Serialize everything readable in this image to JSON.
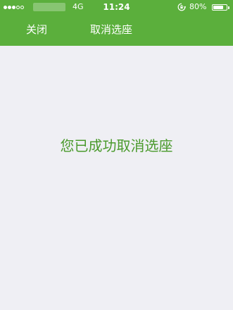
{
  "status_bar": {
    "signal_bars_filled": 3,
    "signal_bars_total": 5,
    "network": "4G",
    "time": "11:24",
    "battery_percent_label": "80%",
    "battery_level": 0.8,
    "icons": [
      "signal-icon",
      "rotation-lock-icon",
      "battery-icon"
    ]
  },
  "nav": {
    "close_label": "关闭",
    "title": "取消选座"
  },
  "main": {
    "message": "您已成功取消选座"
  },
  "colors": {
    "brand_green": "#5BAF3C",
    "message_green": "#4A9A2C",
    "background": "#EFEFF4"
  }
}
